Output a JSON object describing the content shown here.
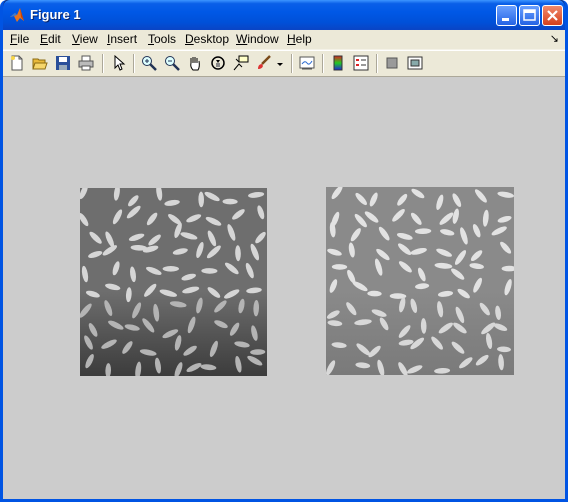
{
  "window": {
    "title": "Figure 1",
    "app_icon": "matlab-icon",
    "controls": [
      "minimize-icon",
      "maximize-icon",
      "close-icon"
    ]
  },
  "menu": {
    "items": [
      {
        "pre": "",
        "key": "F",
        "post": "ile"
      },
      {
        "pre": "",
        "key": "E",
        "post": "dit"
      },
      {
        "pre": "",
        "key": "V",
        "post": "iew"
      },
      {
        "pre": "",
        "key": "I",
        "post": "nsert"
      },
      {
        "pre": "",
        "key": "T",
        "post": "ools"
      },
      {
        "pre": "",
        "key": "D",
        "post": "esktop"
      },
      {
        "pre": "",
        "key": "W",
        "post": "indow"
      },
      {
        "pre": "",
        "key": "H",
        "post": "elp"
      }
    ],
    "dock_arrow": "↘"
  },
  "toolbar": {
    "tools": [
      "new-figure-icon",
      "open-file-icon",
      "save-icon",
      "print-icon",
      "edit-plot-icon",
      "zoom-in-icon",
      "zoom-out-icon",
      "pan-icon",
      "rotate-3d-icon",
      "data-cursor-icon",
      "brush-icon",
      "brush-dropdown-icon",
      "link-plot-icon",
      "colorbar-icon",
      "legend-icon",
      "hide-plot-tools-icon",
      "show-plot-tools-icon"
    ]
  },
  "figure": {
    "background": "#cccccc",
    "images": [
      {
        "name": "original-rice-image",
        "style": "darker, uneven illumination"
      },
      {
        "name": "adjusted-rice-image",
        "style": "lighter, background corrected"
      }
    ]
  }
}
